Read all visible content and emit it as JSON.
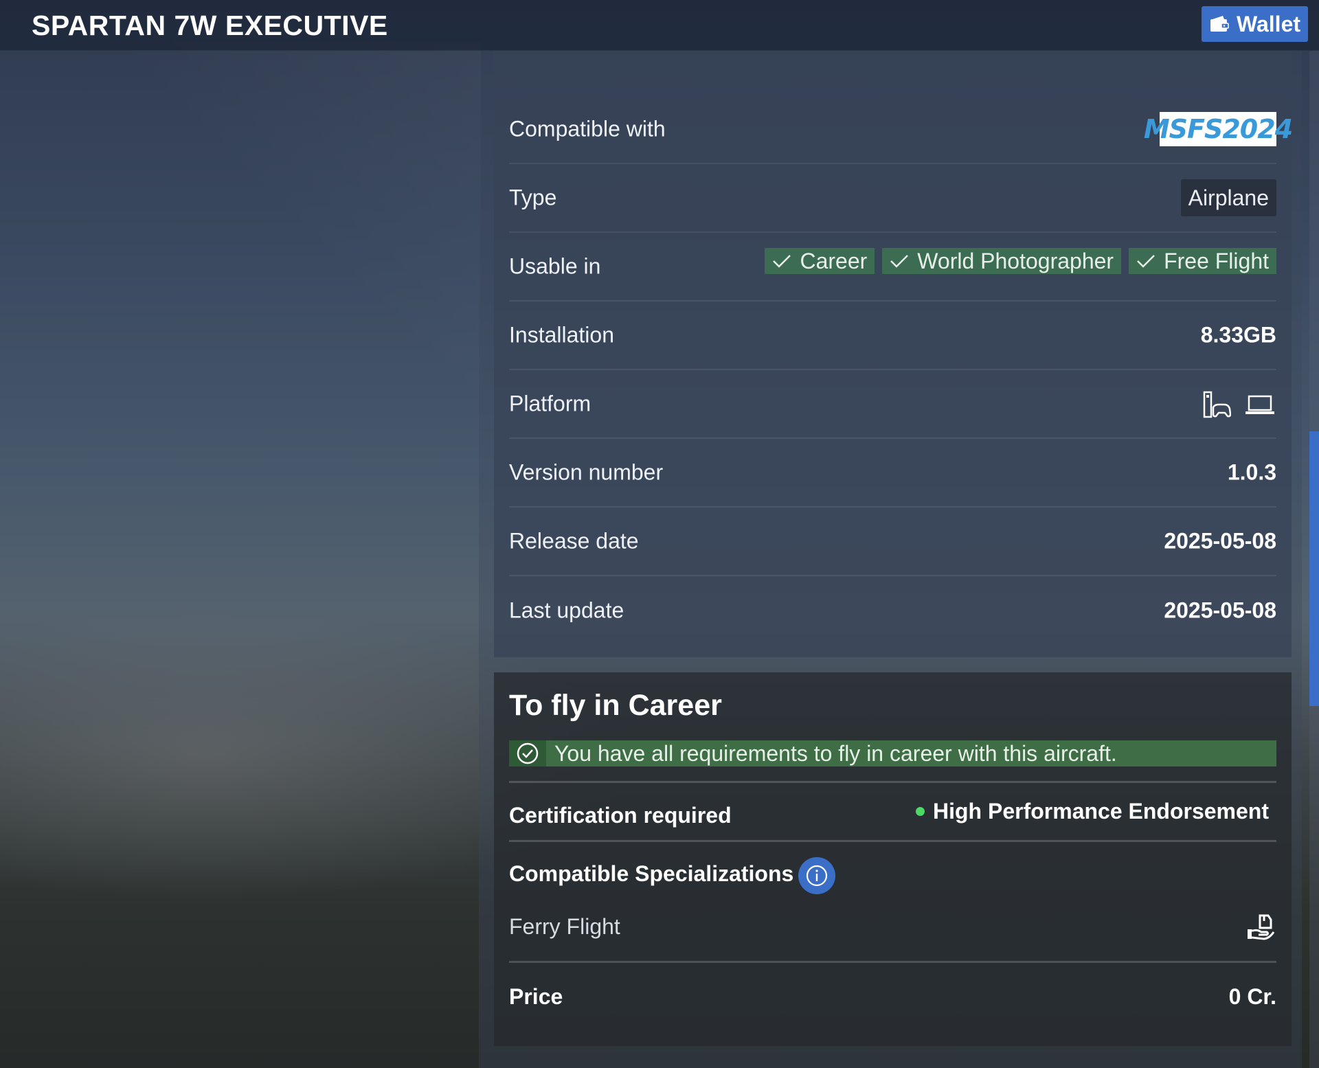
{
  "header": {
    "title": "SPARTAN 7W EXECUTIVE",
    "wallet_label": "Wallet"
  },
  "details": {
    "compatible": {
      "label": "Compatible with",
      "logo_text": "MSFS 2024"
    },
    "type": {
      "label": "Type",
      "value": "Airplane"
    },
    "usable": {
      "label": "Usable in",
      "modes": [
        "Career",
        "World Photographer",
        "Free Flight"
      ]
    },
    "installation": {
      "label": "Installation",
      "value": "8.33GB"
    },
    "platform": {
      "label": "Platform",
      "icons": [
        "xbox-icon",
        "laptop-icon"
      ]
    },
    "version": {
      "label": "Version number",
      "value": "1.0.3"
    },
    "release": {
      "label": "Release date",
      "value": "2025-05-08"
    },
    "last_update": {
      "label": "Last update",
      "value": "2025-05-08"
    }
  },
  "career": {
    "title": "To fly in Career",
    "requirements_message": "You have all requirements to fly in career with this aircraft.",
    "certification_label": "Certification required",
    "certification_value": "High Performance Endorsement",
    "specializations_label": "Compatible Specializations",
    "specializations": [
      "Ferry Flight"
    ],
    "price_label": "Price",
    "price_value": "0 Cr."
  },
  "colors": {
    "accent": "#3a6ec7",
    "success": "#3f6d45",
    "success_dot": "#4cd964"
  }
}
